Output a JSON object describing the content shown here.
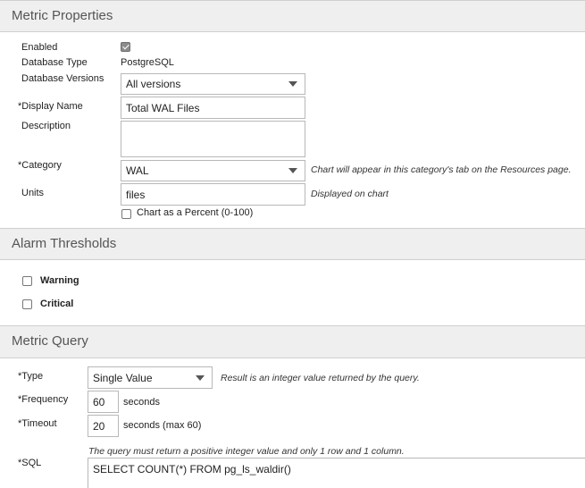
{
  "metric_properties": {
    "title": "Metric Properties",
    "enabled_label": "Enabled",
    "enabled": true,
    "db_type_label": "Database Type",
    "db_type_value": "PostgreSQL",
    "db_versions_label": "Database Versions",
    "db_versions_value": "All versions",
    "display_name_label": "*Display Name",
    "display_name_value": "Total WAL Files",
    "description_label": "Description",
    "description_value": "",
    "category_label": "*Category",
    "category_value": "WAL",
    "category_hint": "Chart will appear in this category's tab on the Resources page.",
    "units_label": "Units",
    "units_value": "files",
    "units_hint": "Displayed on chart",
    "percent_label": "Chart as a Percent (0-100)",
    "percent_checked": false
  },
  "alarm_thresholds": {
    "title": "Alarm Thresholds",
    "warning_label": "Warning",
    "warning_checked": false,
    "critical_label": "Critical",
    "critical_checked": false
  },
  "metric_query": {
    "title": "Metric Query",
    "type_label": "*Type",
    "type_value": "Single Value",
    "type_hint": "Result is an integer value returned by the query.",
    "frequency_label": "*Frequency",
    "frequency_value": "60",
    "frequency_unit": "seconds",
    "timeout_label": "*Timeout",
    "timeout_value": "20",
    "timeout_unit": "seconds (max 60)",
    "sql_hint": "The query must return a positive integer value and only 1 row and 1 column.",
    "sql_label": "*SQL",
    "sql_value": "SELECT COUNT(*) FROM pg_ls_waldir()"
  }
}
